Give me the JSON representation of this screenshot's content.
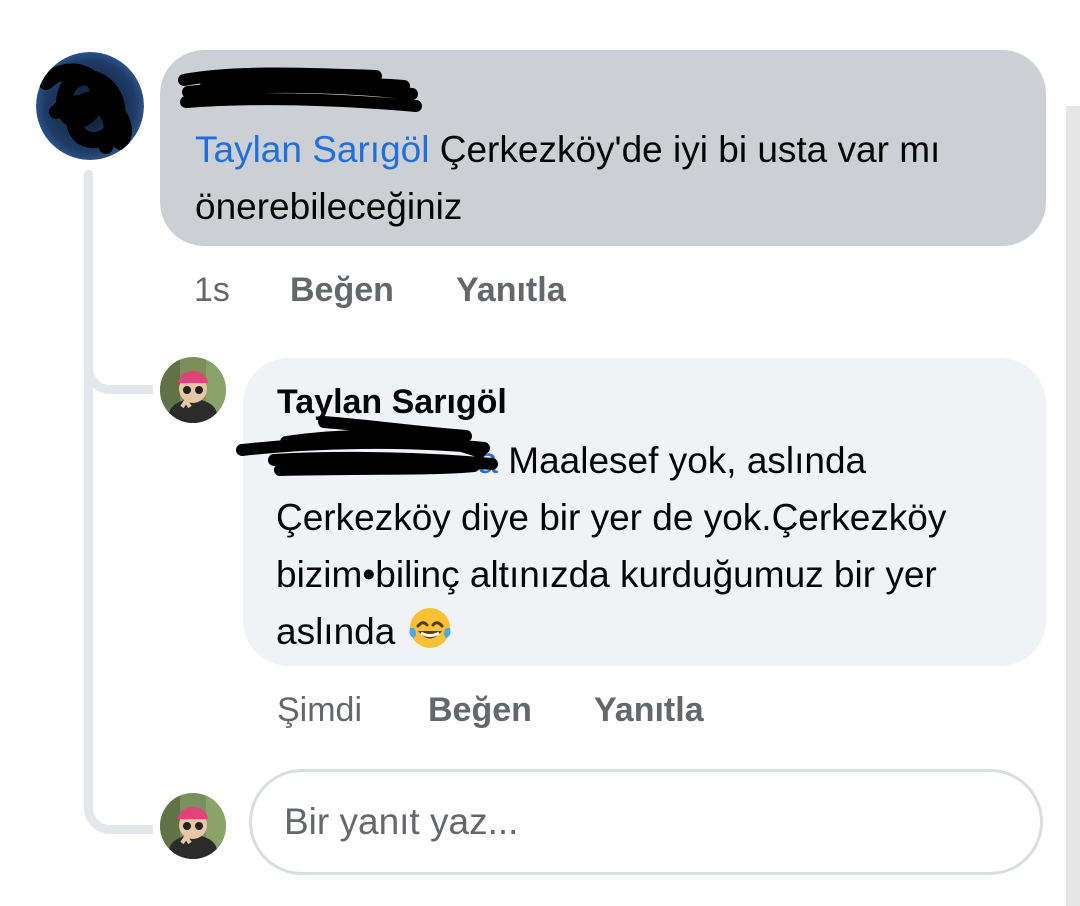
{
  "comment": {
    "author": "",
    "mention": "Taylan Sarıgöl",
    "text": " Çerkezköy'de iyi bi usta var mı önerebileceğiniz",
    "time": "1s",
    "like_label": "Beğen",
    "reply_label": "Yanıtla"
  },
  "reply": {
    "author": "Taylan Sarıgöl",
    "mention_visible": "a",
    "text": " Maalesef yok, aslında Çerkezköy diye bir yer de yok.Çerkezköy bizim•bilinç altınızda kurduğumuz bir yer aslında ",
    "emoji": "face-with-tears-of-joy-emoji",
    "time": "Şimdi",
    "like_label": "Beğen",
    "reply_label": "Yanıtla"
  },
  "reply_box": {
    "placeholder": "Bir yanıt yaz..."
  },
  "colors": {
    "comment_bubble": "#ccd0d5",
    "reply_bubble": "#f0f2f5",
    "mention": "#216fdb",
    "meta_text": "#65676b",
    "thread_line": "#e4e6eb"
  }
}
